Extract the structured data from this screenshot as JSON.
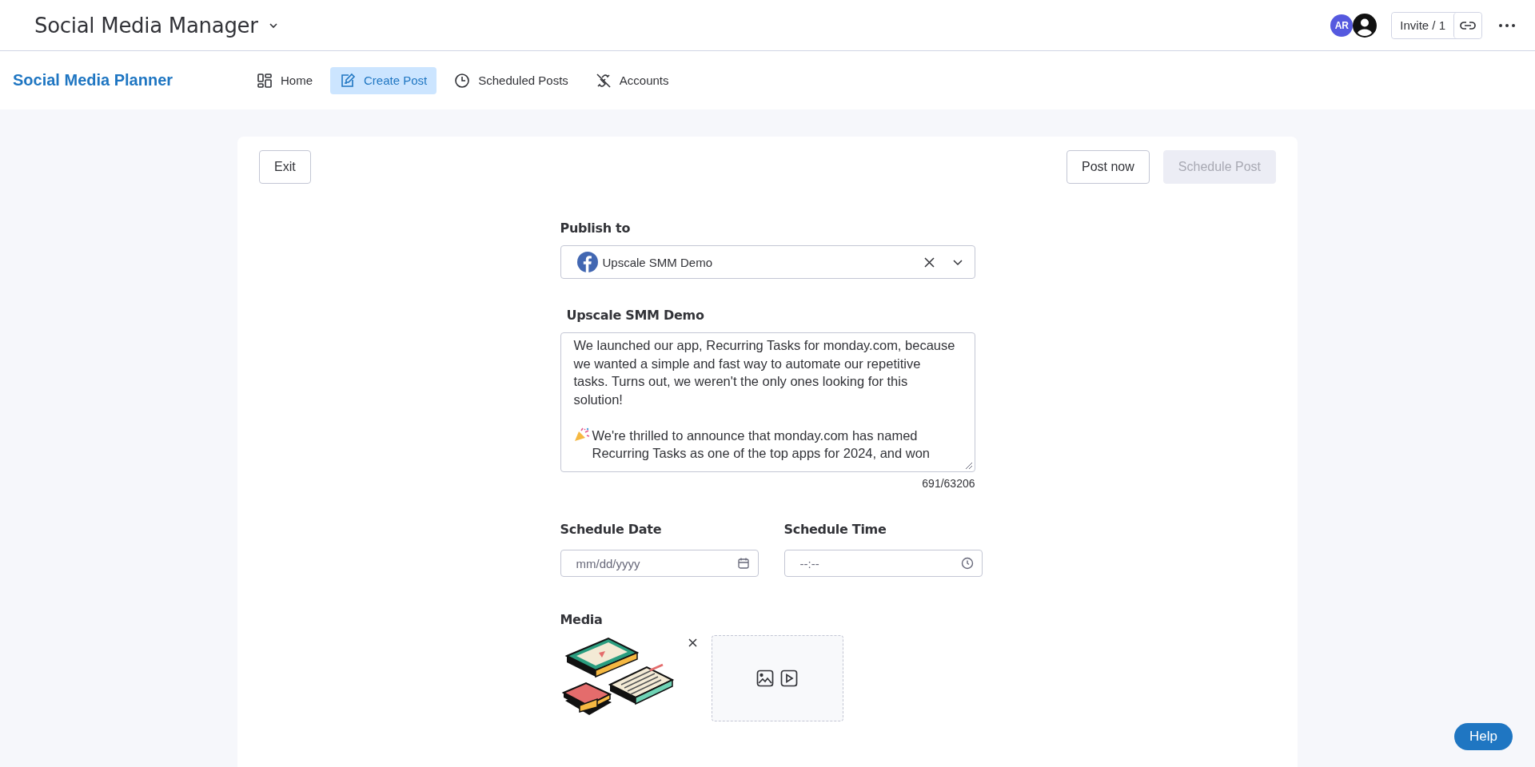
{
  "window": {
    "title": "Social Media Manager"
  },
  "header": {
    "avatar_initials": "AR",
    "invite": "Invite / 1"
  },
  "nav": {
    "brand": "Social Media Planner",
    "items": [
      {
        "label": "Home",
        "selected": false
      },
      {
        "label": "Create Post",
        "selected": true
      },
      {
        "label": "Scheduled Posts",
        "selected": false
      },
      {
        "label": "Accounts",
        "selected": false
      }
    ]
  },
  "toolbar": {
    "exit": "Exit",
    "post_now": "Post now",
    "schedule": {
      "label": "Schedule Post",
      "disabled": true
    }
  },
  "form": {
    "publish_label": "Publish to",
    "account": "Upscale SMM Demo",
    "account_label": "Upscale SMM Demo",
    "paragraphs": [
      {
        "kind": "plain",
        "text": "We launched our app, Recurring Tasks for monday.com, because we wanted a simple and fast way to automate our repetitive tasks. Turns out, we weren't the only ones looking for this solution!"
      },
      {
        "kind": "celebration",
        "text": "We're thrilled to announce that monday.com has named Recurring Tasks as one of the top apps for 2024, and won"
      }
    ],
    "char_count": "691/63206",
    "date_label": "Schedule Date",
    "date_placeholder": "mm/dd/yyyy",
    "time_label": "Schedule Time",
    "time_placeholder": "--:--",
    "media_label": "Media"
  },
  "help": "Help"
}
